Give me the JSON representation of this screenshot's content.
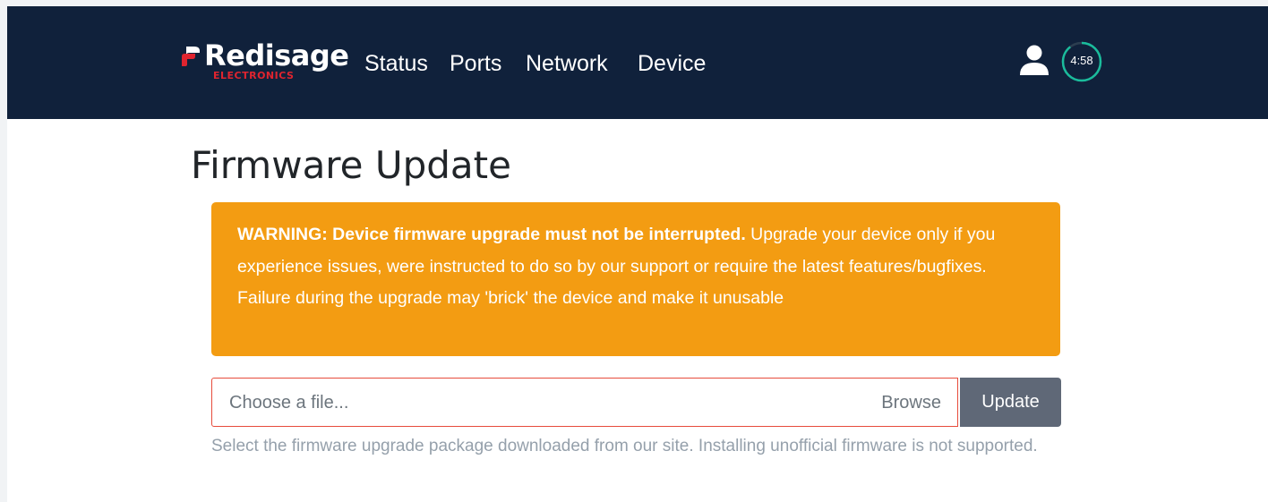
{
  "brand": {
    "name": "Redisage",
    "sub": "ELECTRONICS",
    "accent_color": "#e0242f",
    "icon": "redisage-logo-icon"
  },
  "nav": {
    "items": [
      {
        "label": "Status"
      },
      {
        "label": "Ports"
      },
      {
        "label": "Network"
      },
      {
        "label": "Device"
      }
    ]
  },
  "session": {
    "user_icon": "user-icon",
    "timer": "4:58",
    "ring_color": "#1abc9c"
  },
  "page": {
    "title": "Firmware Update"
  },
  "warning": {
    "strong": "WARNING: Device firmware upgrade must not be interrupted.",
    "text": " Upgrade your device only if you experience issues, were instructed to do so by our support or require the latest features/bugfixes. Failure during the upgrade may 'brick' the device and make it unusable",
    "color": "#f39c12"
  },
  "upload": {
    "placeholder": "Choose a file...",
    "browse_label": "Browse",
    "update_label": "Update",
    "help": "Select the firmware upgrade package downloaded from our site. Installing unofficial firmware is not supported."
  }
}
